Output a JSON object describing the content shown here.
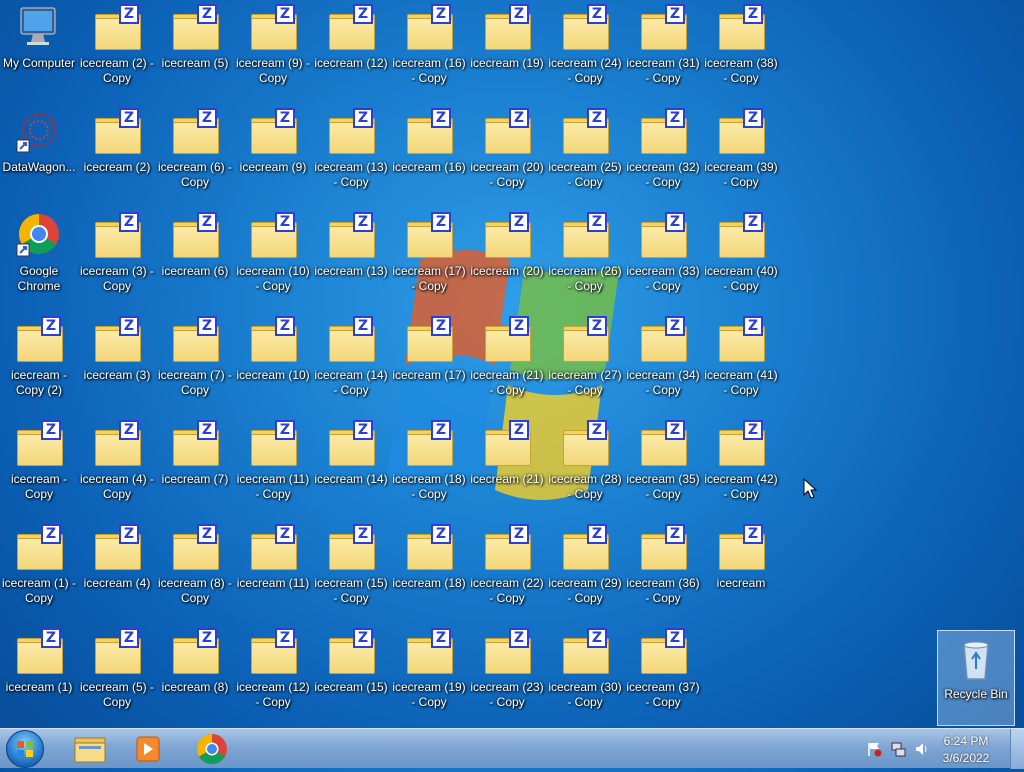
{
  "desktop": {
    "icons": [
      {
        "label": "My Computer",
        "type": "computer"
      },
      {
        "label": "icecream (2) - Copy",
        "type": "zip"
      },
      {
        "label": "icecream (5)",
        "type": "zip"
      },
      {
        "label": "icecream (9) - Copy",
        "type": "zip"
      },
      {
        "label": "icecream (12)",
        "type": "zip"
      },
      {
        "label": "icecream (16) - Copy",
        "type": "zip"
      },
      {
        "label": "icecream (19)",
        "type": "zip"
      },
      {
        "label": "icecream (24) - Copy",
        "type": "zip"
      },
      {
        "label": "icecream (31) - Copy",
        "type": "zip"
      },
      {
        "label": "icecream (38) - Copy",
        "type": "zip"
      },
      {
        "label": "DataWagon...",
        "type": "datawagon"
      },
      {
        "label": "icecream (2)",
        "type": "zip"
      },
      {
        "label": "icecream (6) - Copy",
        "type": "zip"
      },
      {
        "label": "icecream (9)",
        "type": "zip"
      },
      {
        "label": "icecream (13) - Copy",
        "type": "zip"
      },
      {
        "label": "icecream (16)",
        "type": "zip"
      },
      {
        "label": "icecream (20) - Copy",
        "type": "zip"
      },
      {
        "label": "icecream (25) - Copy",
        "type": "zip"
      },
      {
        "label": "icecream (32) - Copy",
        "type": "zip"
      },
      {
        "label": "icecream (39) - Copy",
        "type": "zip"
      },
      {
        "label": "Google Chrome",
        "type": "chrome"
      },
      {
        "label": "icecream (3) - Copy",
        "type": "zip"
      },
      {
        "label": "icecream (6)",
        "type": "zip"
      },
      {
        "label": "icecream (10) - Copy",
        "type": "zip"
      },
      {
        "label": "icecream (13)",
        "type": "zip"
      },
      {
        "label": "icecream (17) - Copy",
        "type": "zip"
      },
      {
        "label": "icecream (20)",
        "type": "zip"
      },
      {
        "label": "icecream (26) - Copy",
        "type": "zip"
      },
      {
        "label": "icecream (33) - Copy",
        "type": "zip"
      },
      {
        "label": "icecream (40) - Copy",
        "type": "zip"
      },
      {
        "label": "icecream - Copy (2)",
        "type": "zip"
      },
      {
        "label": "icecream (3)",
        "type": "zip"
      },
      {
        "label": "icecream (7) - Copy",
        "type": "zip"
      },
      {
        "label": "icecream (10)",
        "type": "zip"
      },
      {
        "label": "icecream (14) - Copy",
        "type": "zip"
      },
      {
        "label": "icecream (17)",
        "type": "zip"
      },
      {
        "label": "icecream (21) - Copy",
        "type": "zip"
      },
      {
        "label": "icecream (27) - Copy",
        "type": "zip"
      },
      {
        "label": "icecream (34) - Copy",
        "type": "zip"
      },
      {
        "label": "icecream (41) - Copy",
        "type": "zip"
      },
      {
        "label": "icecream - Copy",
        "type": "zip"
      },
      {
        "label": "icecream (4) - Copy",
        "type": "zip"
      },
      {
        "label": "icecream (7)",
        "type": "zip"
      },
      {
        "label": "icecream (11) - Copy",
        "type": "zip"
      },
      {
        "label": "icecream (14)",
        "type": "zip"
      },
      {
        "label": "icecream (18) - Copy",
        "type": "zip"
      },
      {
        "label": "icecream (21)",
        "type": "zip"
      },
      {
        "label": "icecream (28) - Copy",
        "type": "zip"
      },
      {
        "label": "icecream (35) - Copy",
        "type": "zip"
      },
      {
        "label": "icecream (42) - Copy",
        "type": "zip"
      },
      {
        "label": "icecream (1) - Copy",
        "type": "zip"
      },
      {
        "label": "icecream (4)",
        "type": "zip"
      },
      {
        "label": "icecream (8) - Copy",
        "type": "zip"
      },
      {
        "label": "icecream (11)",
        "type": "zip"
      },
      {
        "label": "icecream (15) - Copy",
        "type": "zip"
      },
      {
        "label": "icecream (18)",
        "type": "zip"
      },
      {
        "label": "icecream (22) - Copy",
        "type": "zip"
      },
      {
        "label": "icecream (29) - Copy",
        "type": "zip"
      },
      {
        "label": "icecream (36) - Copy",
        "type": "zip"
      },
      {
        "label": "icecream",
        "type": "zip"
      },
      {
        "label": "icecream (1)",
        "type": "zip"
      },
      {
        "label": "icecream (5) - Copy",
        "type": "zip"
      },
      {
        "label": "icecream (8)",
        "type": "zip"
      },
      {
        "label": "icecream (12) - Copy",
        "type": "zip"
      },
      {
        "label": "icecream (15)",
        "type": "zip"
      },
      {
        "label": "icecream (19) - Copy",
        "type": "zip"
      },
      {
        "label": "icecream (23) - Copy",
        "type": "zip"
      },
      {
        "label": "icecream (30) - Copy",
        "type": "zip"
      },
      {
        "label": "icecream (37) - Copy",
        "type": "zip"
      }
    ],
    "recycle_bin": {
      "label": "Recycle Bin"
    },
    "zip_badge_letter": "Z"
  },
  "taskbar": {
    "pinned": [
      {
        "name": "windows-explorer",
        "icon": "folder-icon"
      },
      {
        "name": "windows-media-player",
        "icon": "media-player-icon"
      },
      {
        "name": "google-chrome",
        "icon": "chrome-icon"
      }
    ],
    "clock": {
      "time": "6:24 PM",
      "date": "3/6/2022"
    }
  },
  "colors": {
    "accent": "#2a3ed8",
    "folder": "#f3d67a",
    "taskbar": "#7fa6d3"
  }
}
